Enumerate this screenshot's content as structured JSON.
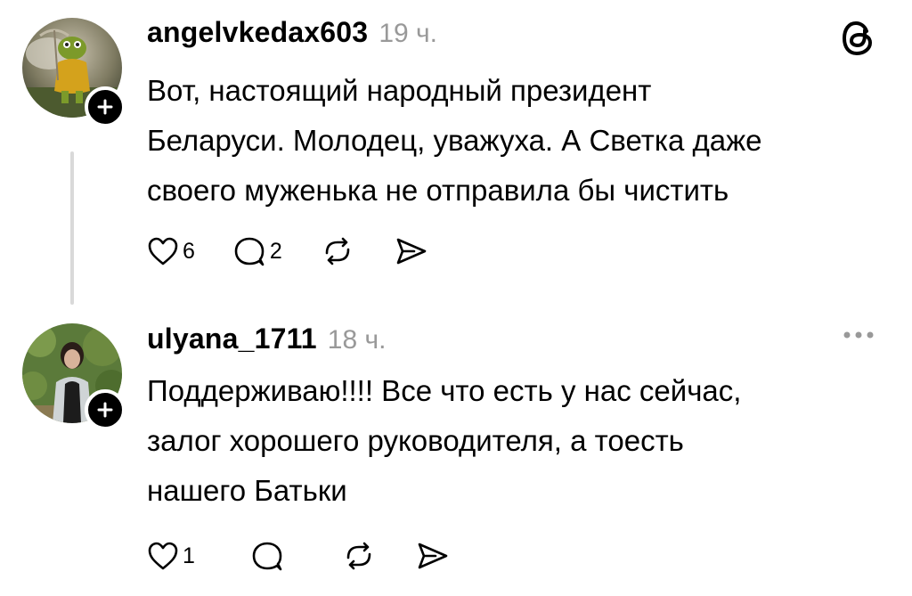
{
  "posts": [
    {
      "username": "angelvkedax603",
      "time": "19 ч.",
      "text_lines": [
        "Вот, настоящий народный президент",
        "Беларуси. Молодец, уважуха. А Светка даже",
        "своего муженька не отправила бы чистить"
      ],
      "likes": "6",
      "replies": "2",
      "corner_icon": "threads-logo-icon"
    },
    {
      "username": "ulyana_1711",
      "time": "18 ч.",
      "text_lines": [
        "Поддерживаю!!!! Все что есть у нас сейчас,",
        "залог хорошего руководителя, а тоесть",
        "нашего Батьки"
      ],
      "likes": "1",
      "replies": "",
      "corner_icon": "more-options-icon"
    }
  ],
  "icons": {
    "like": "heart-icon",
    "reply": "comment-icon",
    "repost": "repost-icon",
    "share": "send-icon",
    "follow": "plus-icon"
  }
}
